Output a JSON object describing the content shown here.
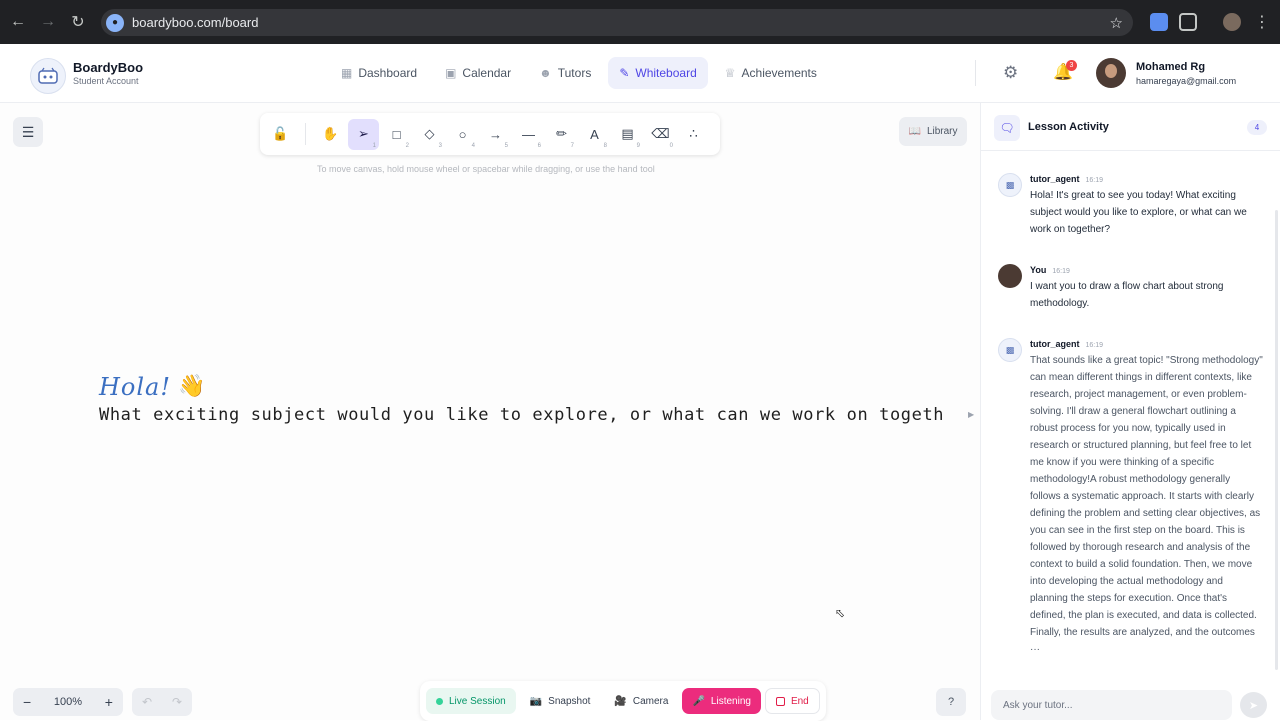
{
  "browser": {
    "url": "boardyboo.com/board"
  },
  "brand": {
    "name": "BoardyBoo",
    "subtitle": "Student Account"
  },
  "nav": {
    "items": [
      {
        "label": "Dashboard",
        "icon": "grid-icon"
      },
      {
        "label": "Calendar",
        "icon": "calendar-icon"
      },
      {
        "label": "Tutors",
        "icon": "users-icon"
      },
      {
        "label": "Whiteboard",
        "icon": "pen-icon",
        "active": true
      },
      {
        "label": "Achievements",
        "icon": "trophy-icon"
      }
    ]
  },
  "header": {
    "notification_count": "3",
    "user_name": "Mohamed Rg",
    "user_email": "hamaregaya@gmail.com"
  },
  "toolbar": {
    "tools": [
      {
        "name": "lock",
        "key": ""
      },
      {
        "name": "hand",
        "key": ""
      },
      {
        "name": "select",
        "key": "1"
      },
      {
        "name": "rectangle",
        "key": "2"
      },
      {
        "name": "diamond",
        "key": "3"
      },
      {
        "name": "ellipse",
        "key": "4"
      },
      {
        "name": "arrow",
        "key": "5"
      },
      {
        "name": "line",
        "key": "6"
      },
      {
        "name": "pencil",
        "key": "7"
      },
      {
        "name": "text",
        "key": "8"
      },
      {
        "name": "image",
        "key": "9"
      },
      {
        "name": "eraser",
        "key": "0"
      },
      {
        "name": "shapes",
        "key": ""
      }
    ],
    "hint": "To move canvas, hold mouse wheel or spacebar while dragging, or use the hand tool",
    "library_label": "Library"
  },
  "canvas": {
    "greeting": "Hola!",
    "line": "What exciting subject would you like to explore, or what can we work on togeth"
  },
  "zoom": {
    "level": "100%"
  },
  "session": {
    "live_label": "Live Session",
    "snapshot_label": "Snapshot",
    "camera_label": "Camera",
    "listening_label": "Listening",
    "end_label": "End"
  },
  "panel": {
    "title": "Lesson Activity",
    "count": "4",
    "messages": [
      {
        "author": "tutor_agent",
        "time": "16:19",
        "text": "Hola! It's great to see you today! What exciting subject would you like to explore, or what can we work on together?"
      },
      {
        "author": "You",
        "time": "16:19",
        "text": "I want you to draw a flow chart about strong methodology."
      },
      {
        "author": "tutor_agent",
        "time": "16:19",
        "text": "That sounds like a great topic! \"Strong methodology\" can mean different things in different contexts, like research, project management, or even problem-solving. I'll draw a general flowchart outlining a robust process for you now, typically used in research or structured planning, but feel free to let me know if you were thinking of a specific methodology!A robust methodology generally follows a systematic approach. It starts with clearly defining the problem and setting clear objectives, as you can see in the first step on the board. This is followed by thorough research and analysis of the context to build a solid foundation. Then, we move into developing the actual methodology and planning the steps for execution. Once that's defined, the plan is executed, and data is collected. Finally, the results are analyzed, and the outcomes ···"
      }
    ],
    "input_placeholder": "Ask your tutor..."
  }
}
